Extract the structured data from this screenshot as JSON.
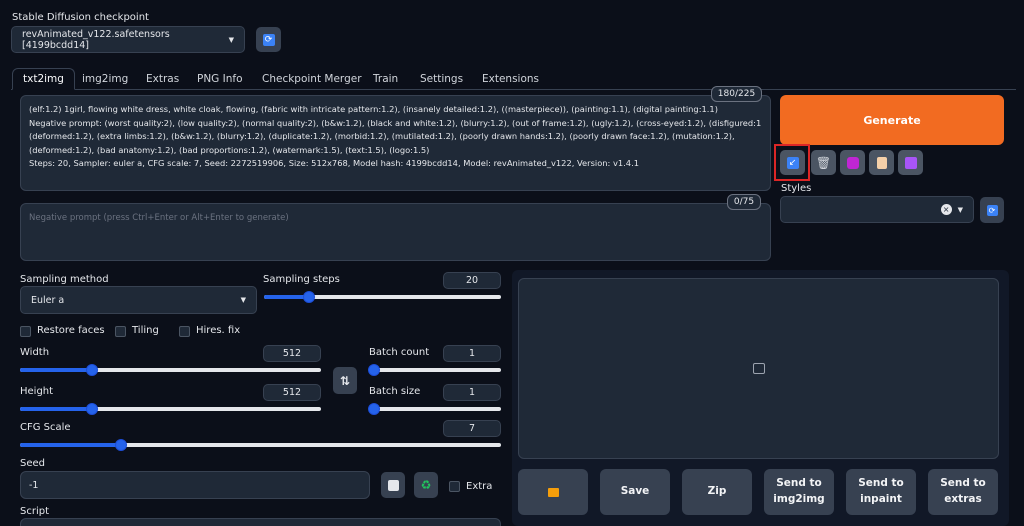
{
  "checkpoint": {
    "label": "Stable Diffusion checkpoint",
    "value": "revAnimated_v122.safetensors [4199bcdd14]"
  },
  "tabs": [
    "txt2img",
    "img2img",
    "Extras",
    "PNG Info",
    "Checkpoint Merger",
    "Train",
    "Settings",
    "Extensions"
  ],
  "prompt": {
    "counter": "180/225",
    "lines": [
      "(elf:1.2) 1girl, flowing white dress, white cloak, flowing, (fabric with intricate pattern:1.2), (insanely detailed:1.2), ((masterpiece)), (painting:1.1), (digital painting:1.1)",
      "Negative prompt: (worst quality:2), (low quality:2), (normal quality:2), (b&w:1.2), (black and white:1.2), (blurry:1.2), (out of frame:1.2), (ugly:1.2), (cross-eyed:1.2), (disfigured:1.2),",
      "(deformed:1.2), (extra limbs:1.2), (b&w:1.2), (blurry:1.2), (duplicate:1.2), (morbid:1.2), (mutilated:1.2), (poorly drawn hands:1.2), (poorly drawn face:1.2), (mutation:1.2),",
      "(deformed:1.2), (bad anatomy:1.2), (bad proportions:1.2), (watermark:1.5), (text:1.5), (logo:1.5)",
      "Steps: 20, Sampler: euler a, CFG scale: 7, Seed: 2272519906, Size: 512x768, Model hash: 4199bcdd14, Model: revAnimated_v122, Version: v1.4.1"
    ]
  },
  "negative_prompt": {
    "counter": "0/75",
    "placeholder": "Negative prompt (press Ctrl+Enter or Alt+Enter to generate)"
  },
  "generate_label": "Generate",
  "styles_label": "Styles",
  "sampling_method": {
    "label": "Sampling method",
    "value": "Euler a"
  },
  "sampling_steps": {
    "label": "Sampling steps",
    "value": "20",
    "fraction": 0.19
  },
  "options": {
    "restore_faces": "Restore faces",
    "tiling": "Tiling",
    "hires_fix": "Hires. fix"
  },
  "width": {
    "label": "Width",
    "value": "512",
    "fraction": 0.24
  },
  "height": {
    "label": "Height",
    "value": "512",
    "fraction": 0.24
  },
  "batch_count": {
    "label": "Batch count",
    "value": "1",
    "fraction": 0.0
  },
  "batch_size": {
    "label": "Batch size",
    "value": "1",
    "fraction": 0.0
  },
  "cfg_scale": {
    "label": "CFG Scale",
    "value": "7",
    "fraction": 0.21
  },
  "seed": {
    "label": "Seed",
    "value": "-1",
    "extra_label": "Extra"
  },
  "script_label": "Script",
  "output_buttons": {
    "save": "Save",
    "zip": "Zip",
    "send_img2img": [
      "Send to",
      "img2img"
    ],
    "send_inpaint": [
      "Send to",
      "inpaint"
    ],
    "send_extras": [
      "Send to",
      "extras"
    ]
  },
  "colors": {
    "generate": "#f26b21",
    "accent": "#2563eb",
    "highlight_box": "#dc2626"
  }
}
